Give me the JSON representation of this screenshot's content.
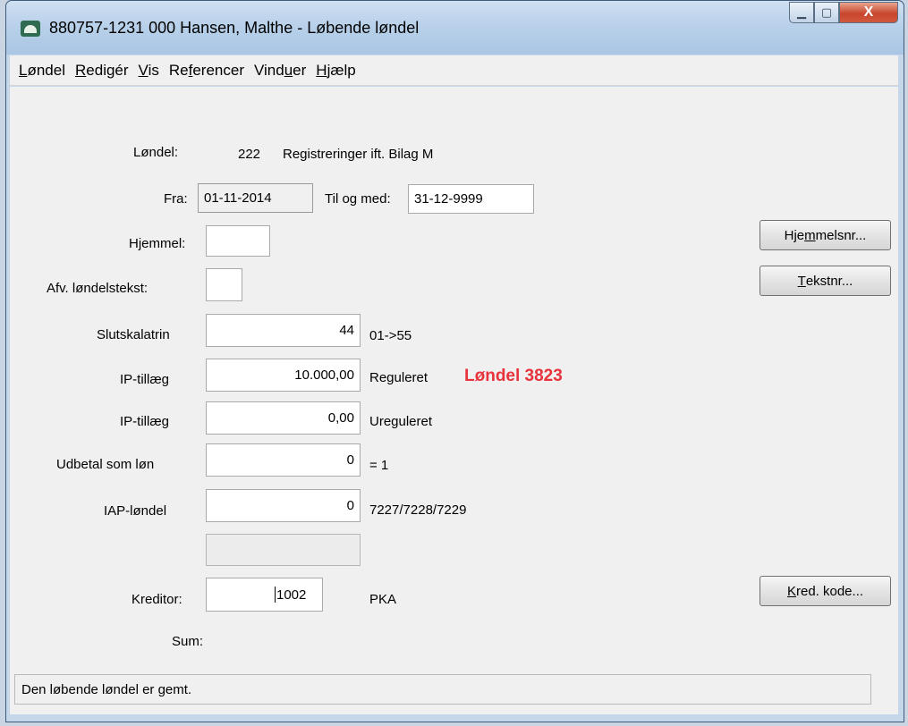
{
  "window": {
    "title": "880757-1231 000 Hansen, Malthe - Løbende løndel",
    "minimize_glyph": "▁",
    "maximize_glyph": "▢",
    "close_glyph": "X"
  },
  "menu": [
    {
      "pre": "",
      "ul": "L",
      "post": "øndel"
    },
    {
      "pre": "",
      "ul": "R",
      "post": "edigér"
    },
    {
      "pre": "",
      "ul": "V",
      "post": "is"
    },
    {
      "pre": "Re",
      "ul": "f",
      "post": "erencer"
    },
    {
      "pre": "Vind",
      "ul": "u",
      "post": "er"
    },
    {
      "pre": "",
      "ul": "H",
      "post": "jælp"
    }
  ],
  "form": {
    "londel_label": "Løndel:",
    "londel_number": "222",
    "londel_name": "Registreringer ift. Bilag M",
    "fra_label": "Fra:",
    "fra_value": "01-11-2014",
    "til_label": "Til og med:",
    "til_value": "31-12-9999",
    "hjemmel_label": "Hjemmel:",
    "hjemmel_value": "",
    "afv_label": "Afv. løndelstekst:",
    "afv_value": "",
    "slutskalatrin_label": "Slutskalatrin",
    "slutskalatrin_value": "44",
    "slutskalatrin_note": "01->55",
    "ip1_label": "IP-tillæg",
    "ip1_value": "10.000,00",
    "ip1_note": "Reguleret",
    "ip2_label": "IP-tillæg",
    "ip2_value": "0,00",
    "ip2_note": "Ureguleret",
    "udbetal_label": "Udbetal som løn",
    "udbetal_value": "0",
    "udbetal_note": "= 1",
    "iap_label": "IAP-løndel",
    "iap_value": "0",
    "iap_note": "7227/7228/7229",
    "blank_value": "",
    "kreditor_label": "Kreditor:",
    "kreditor_value": "1002",
    "kreditor_name": "PKA",
    "sum_label": "Sum:"
  },
  "annotation": {
    "text": "Løndel 3823",
    "color": "#e8323c"
  },
  "buttons": {
    "hjemmelsnr": {
      "pre": "Hje",
      "ul": "m",
      "post": "melsnr..."
    },
    "tekstnr": {
      "pre": "",
      "ul": "T",
      "post": "ekstnr..."
    },
    "kred_kode": {
      "pre": "",
      "ul": "K",
      "post": "red. kode..."
    }
  },
  "status": {
    "text": "Den løbende løndel er gemt."
  }
}
